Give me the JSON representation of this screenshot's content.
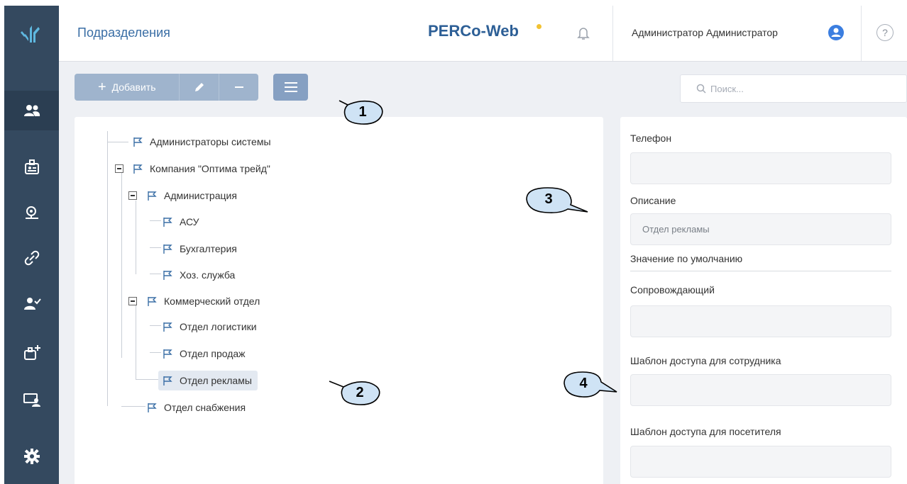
{
  "header": {
    "title": "Подразделения",
    "brand": "PERCo-Web",
    "user": "Администратор Администратор",
    "help": "?"
  },
  "toolbar": {
    "add_label": "Добавить",
    "search_placeholder": "Поиск..."
  },
  "rail": {
    "icons": [
      "logo-icon",
      "users-icon",
      "badge-icon",
      "location-icon",
      "link-icon",
      "user-check-icon",
      "badge-add-icon",
      "monitor-user-icon",
      "gear-icon"
    ],
    "active": "users-icon",
    "color": "#34495f"
  },
  "tree": {
    "items": [
      {
        "label": "Администраторы системы"
      },
      {
        "label": "Компания \"Оптима трейд\""
      },
      {
        "label": "Администрация"
      },
      {
        "label": "АСУ"
      },
      {
        "label": "Бухгалтерия"
      },
      {
        "label": "Хоз. служба"
      },
      {
        "label": "Коммерческий отдел"
      },
      {
        "label": "Отдел логистики"
      },
      {
        "label": "Отдел продаж"
      },
      {
        "label": "Отдел рекламы"
      },
      {
        "label": "Отдел снабжения"
      }
    ],
    "selected": "Отдел рекламы"
  },
  "details": {
    "phone_label": "Телефон",
    "phone_value": "",
    "description_label": "Описание",
    "description_value": "Отдел рекламы",
    "default_label": "Значение по умолчанию",
    "escort_label": "Сопровождающий",
    "escort_value": "",
    "employee_template_label": "Шаблон доступа для сотрудника",
    "employee_template_value": "",
    "visitor_template_label": "Шаблон доступа для посетителя",
    "visitor_template_value": ""
  },
  "callouts": [
    "1",
    "2",
    "3",
    "4"
  ],
  "colors": {
    "accent": "#3a6ea5",
    "brand_dot": "#f2c232",
    "avatar": "#3b7ee0",
    "button": "#9fb4cd"
  }
}
